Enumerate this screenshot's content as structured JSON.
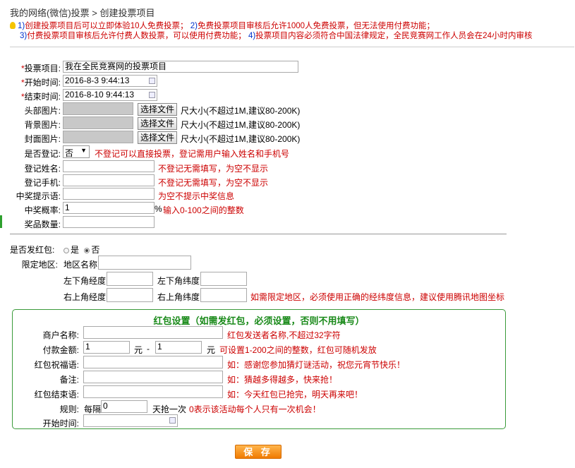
{
  "breadcrumb": {
    "part1": "我的网络(微信)投票",
    "sep": ">",
    "part2": "创建投票项目"
  },
  "notice": [
    {
      "num": "1)",
      "text": "创建投票项目后可以立即体验10人免费投票；"
    },
    {
      "num": "2)",
      "text": "免费投票项目审核后允许1000人免费投票，但无法使用付费功能；"
    },
    {
      "num": "3)",
      "text": "付费投票项目审核后允许付费人数投票，可以使用付费功能；"
    },
    {
      "num": "4)",
      "text": "投票项目内容必须符合中国法律规定，全民竞赛网工作人员会在24小时内审核"
    }
  ],
  "form": {
    "required_mark": "*",
    "project": {
      "label": "投票项目:",
      "value": "我在全民竞赛网的投票项目"
    },
    "start": {
      "label": "开始时间:",
      "value": "2016-8-3 9:44:13"
    },
    "end": {
      "label": "结束时间:",
      "value": "2016-8-10 9:44:13"
    },
    "head_img": {
      "label": "头部图片:"
    },
    "bg_img": {
      "label": "背景图片:"
    },
    "cover_img": {
      "label": "封面图片:"
    },
    "file_button": "选择文件",
    "img_hint": "尺大小(不超过1M,建议80-200K)",
    "register": {
      "label": "是否登记:",
      "value": "否",
      "hint": "不登记可以直接投票，登记需用户输入姓名和手机号"
    },
    "reg_name": {
      "label": "登记姓名:",
      "hint": "不登记无需填写，为空不显示"
    },
    "reg_phone": {
      "label": "登记手机:",
      "hint": "不登记无需填写，为空不显示"
    },
    "prize_tip": {
      "label": "中奖提示语:",
      "hint": "为空不提示中奖信息"
    },
    "prize_rate": {
      "label": "中奖概率:",
      "value": "1",
      "unit": "%",
      "hint": "输入0-100之间的整数"
    },
    "prize_count": {
      "label": "奖品数量:"
    }
  },
  "redpack": {
    "label": "是否发红包:",
    "opt_yes": "是",
    "opt_no": "否",
    "region_label": "限定地区:",
    "region_name": "地区名称",
    "ll_lng": "左下角经度",
    "ll_lat": "左下角纬度",
    "ur_lng": "右上角经度",
    "ur_lat": "右上角纬度",
    "region_hint": "如需限定地区，必须使用正确的经纬度信息，建议使用腾讯地图坐标"
  },
  "box": {
    "title": "红包设置（如需发红包，必须设置，否则不用填写）",
    "merchant": {
      "label": "商户名称:",
      "hint": "红包发送者名称,不超过32字符"
    },
    "amount": {
      "label": "付款金额:",
      "min": "1",
      "yuan": "元",
      "dash": "-",
      "max": "1",
      "hint_yuan": "元",
      "hint": "可设置1-200之间的整数，红包可随机发放"
    },
    "wish": {
      "label": "红包祝福语:",
      "hint": "如：感谢您参加猜灯谜活动，祝您元宵节快乐！"
    },
    "remark": {
      "label": "备注:",
      "hint": "如：猜越多得越多，快来抢！"
    },
    "end_msg": {
      "label": "红包结束语:",
      "hint": "如：今天红包已抢完，明天再来吧！"
    },
    "rule": {
      "label": "规则:",
      "prefix": "每隔",
      "value": "0",
      "suffix": "天抢一次",
      "hint": "0表示该活动每个人只有一次机会！"
    },
    "start": {
      "label": "开始时间:"
    }
  },
  "save_label": "保 存"
}
